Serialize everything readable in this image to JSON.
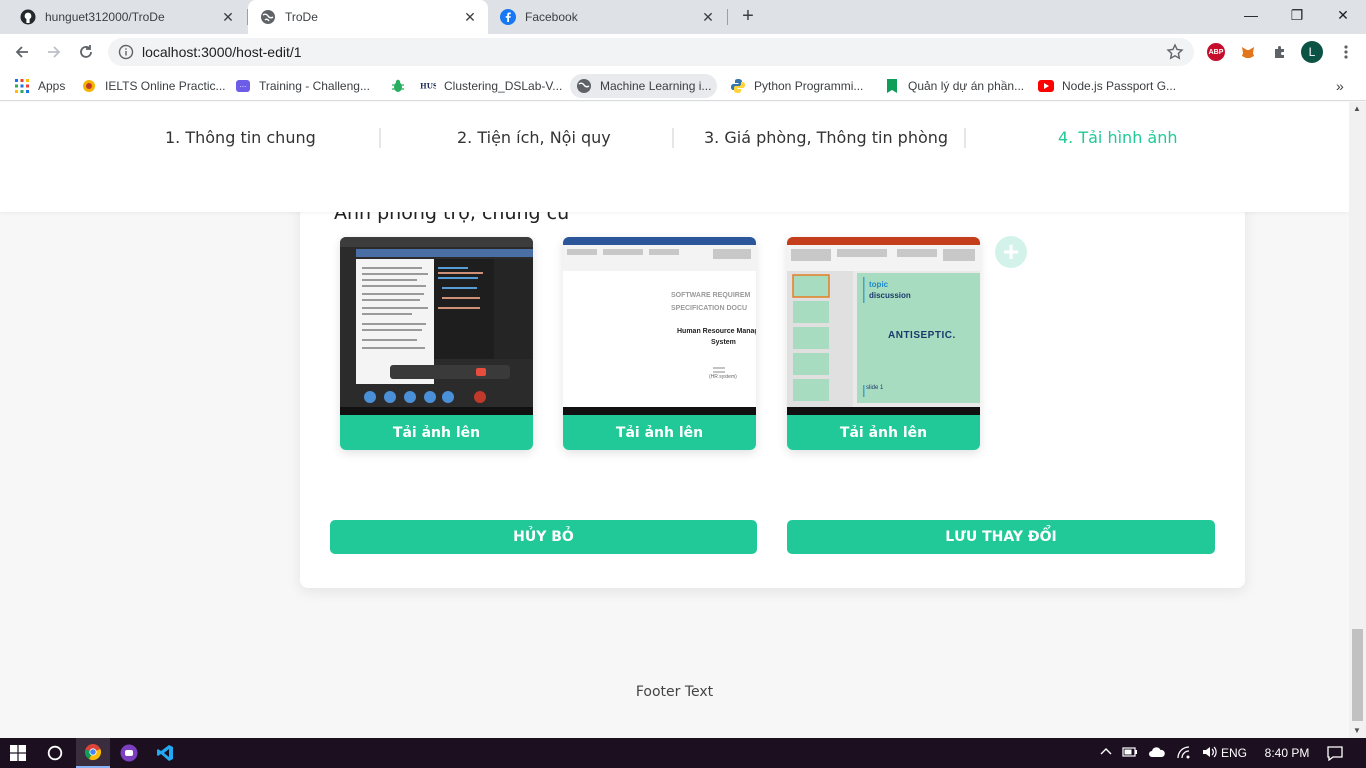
{
  "browser": {
    "tabs": [
      {
        "title": "hunguet312000/TroDe",
        "icon": "github-icon",
        "active": false
      },
      {
        "title": "TroDe",
        "icon": "globe-icon",
        "active": true
      },
      {
        "title": "Facebook",
        "icon": "facebook-icon",
        "active": false
      }
    ],
    "url": "localhost:3000/host-edit/1",
    "profile_initial": "L",
    "abp_label": "ABP"
  },
  "bookmarks": [
    {
      "label": "Apps",
      "icon": "apps-grid-icon"
    },
    {
      "label": "IELTS Online Practic...",
      "icon": "ielts-icon"
    },
    {
      "label": "Training - Challeng...",
      "icon": "training-icon"
    },
    {
      "label": "",
      "icon": "bug-icon"
    },
    {
      "label": "Clustering_DSLab-V...",
      "icon": "hust-icon"
    },
    {
      "label": "Machine Learning i...",
      "icon": "globe-icon"
    },
    {
      "label": "Python Programmi...",
      "icon": "python-icon"
    },
    {
      "label": "Quản lý dự án phần...",
      "icon": "bookmark-icon"
    },
    {
      "label": "Node.js Passport G...",
      "icon": "youtube-icon"
    }
  ],
  "stepper": {
    "steps": [
      "1. Thông tin chung",
      "2. Tiện ích, Nội quy",
      "3. Giá phòng, Thông tin phòng",
      "4. Tải hình ảnh"
    ],
    "active_index": 3,
    "accent": "#20c997"
  },
  "main": {
    "section_title": "Ảnh phòng trọ, chung cư",
    "photos": [
      {
        "upload_label": "Tải ảnh lên",
        "thumb": "screenshot-video-call"
      },
      {
        "upload_label": "Tải ảnh lên",
        "thumb": "screenshot-word-document",
        "doc_title_1": "SOFTWARE REQUIREM",
        "doc_title_2": "SPECIFICATION DOCU",
        "doc_sub_1": "Human Resource Manage",
        "doc_sub_2": "System",
        "doc_caption": "(HR system)"
      },
      {
        "upload_label": "Tải ảnh lên",
        "thumb": "screenshot-powerpoint",
        "slide_topic": "topic",
        "slide_discussion": "discussion",
        "slide_heading": "ANTISEPTIC.",
        "slide_footer": "slide 1"
      }
    ],
    "cancel_label": "HỦY BỎ",
    "save_label": "LƯU THAY ĐỔI"
  },
  "footer": {
    "text": "Footer Text"
  },
  "taskbar": {
    "lang": "ENG",
    "time": "8:40 PM"
  }
}
